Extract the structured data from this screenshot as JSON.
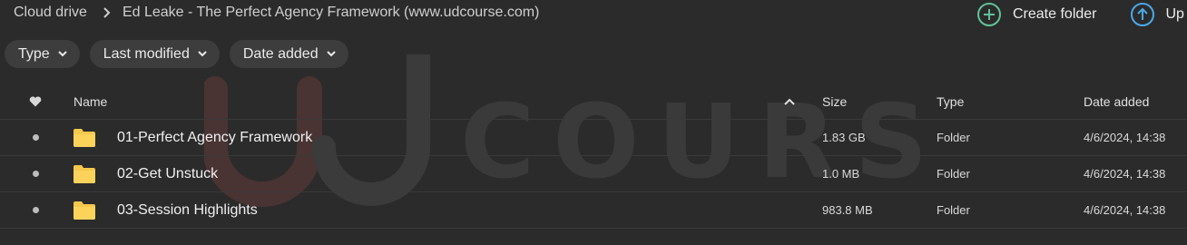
{
  "breadcrumb": {
    "root": "Cloud drive",
    "current": "Ed Leake - The Perfect Agency Framework (www.udcourse.com)"
  },
  "actions": {
    "create_folder": "Create folder",
    "upload": "Up"
  },
  "filters": {
    "type": "Type",
    "last_modified": "Last modified",
    "date_added": "Date added"
  },
  "watermark": "COURSE",
  "table": {
    "headers": {
      "name": "Name",
      "size": "Size",
      "type": "Type",
      "date_added": "Date added"
    },
    "rows": [
      {
        "name": "01-Perfect Agency Framework",
        "size": "1.83 GB",
        "type": "Folder",
        "date_added": "4/6/2024, 14:38"
      },
      {
        "name": "02-Get Unstuck",
        "size": "1.0 MB",
        "type": "Folder",
        "date_added": "4/6/2024, 14:38"
      },
      {
        "name": "03-Session Highlights",
        "size": "983.8 MB",
        "type": "Folder",
        "date_added": "4/6/2024, 14:38"
      }
    ]
  },
  "colors": {
    "background": "#2b2b2b",
    "chip": "#3d3d3d",
    "create_folder_accent": "#5fc39a",
    "upload_accent": "#4aa8e8",
    "folder": "#f5c84c",
    "watermark_red": "#5a3434"
  },
  "icons": {
    "breadcrumb_separator": "chevron-right-icon",
    "create_folder": "plus-circle-icon",
    "upload": "arrow-up-circle-icon",
    "filter_chevron": "chevron-down-icon",
    "favorite_header": "heart-icon",
    "sort": "chevron-up-icon",
    "folder": "folder-icon"
  }
}
